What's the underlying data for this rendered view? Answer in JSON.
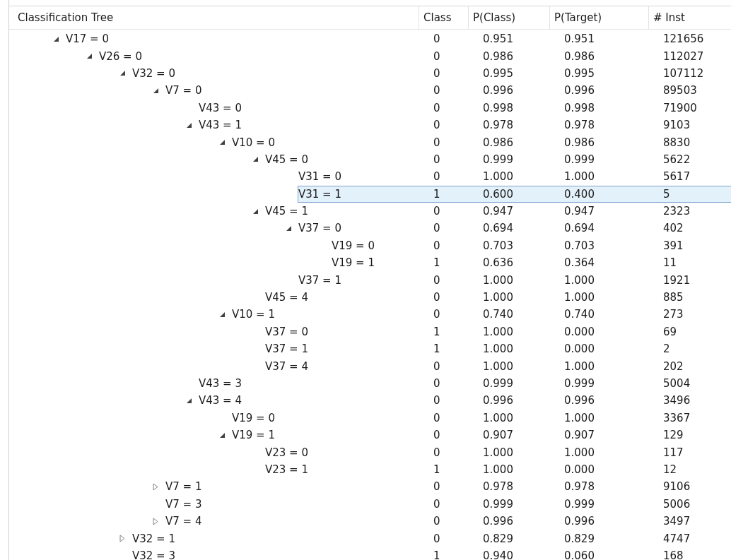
{
  "columns": [
    "Classification Tree",
    "Class",
    "P(Class)",
    "P(Target)",
    "# Inst"
  ],
  "tree": [
    {
      "label": "V17 = 0",
      "kind": "branch",
      "expanded": true,
      "selected": false,
      "class": "0",
      "p_class": "0.951",
      "p_target": "0.951",
      "inst": "121656",
      "children": [
        {
          "label": "V26 = 0",
          "kind": "branch",
          "expanded": true,
          "selected": false,
          "class": "0",
          "p_class": "0.986",
          "p_target": "0.986",
          "inst": "112027",
          "children": [
            {
              "label": "V32 = 0",
              "kind": "branch",
              "expanded": true,
              "selected": false,
              "class": "0",
              "p_class": "0.995",
              "p_target": "0.995",
              "inst": "107112",
              "children": [
                {
                  "label": "V7 = 0",
                  "kind": "branch",
                  "expanded": true,
                  "selected": false,
                  "class": "0",
                  "p_class": "0.996",
                  "p_target": "0.996",
                  "inst": "89503",
                  "children": [
                    {
                      "label": "V43 = 0",
                      "kind": "leaf",
                      "selected": false,
                      "class": "0",
                      "p_class": "0.998",
                      "p_target": "0.998",
                      "inst": "71900"
                    },
                    {
                      "label": "V43 = 1",
                      "kind": "branch",
                      "expanded": true,
                      "selected": false,
                      "class": "0",
                      "p_class": "0.978",
                      "p_target": "0.978",
                      "inst": "9103",
                      "children": [
                        {
                          "label": "V10 = 0",
                          "kind": "branch",
                          "expanded": true,
                          "selected": false,
                          "class": "0",
                          "p_class": "0.986",
                          "p_target": "0.986",
                          "inst": "8830",
                          "children": [
                            {
                              "label": "V45 = 0",
                              "kind": "branch",
                              "expanded": true,
                              "selected": false,
                              "class": "0",
                              "p_class": "0.999",
                              "p_target": "0.999",
                              "inst": "5622",
                              "children": [
                                {
                                  "label": "V31 = 0",
                                  "kind": "leaf",
                                  "selected": false,
                                  "class": "0",
                                  "p_class": "1.000",
                                  "p_target": "1.000",
                                  "inst": "5617"
                                },
                                {
                                  "label": "V31 = 1",
                                  "kind": "leaf",
                                  "selected": true,
                                  "class": "1",
                                  "p_class": "0.600",
                                  "p_target": "0.400",
                                  "inst": "5"
                                }
                              ]
                            },
                            {
                              "label": "V45 = 1",
                              "kind": "branch",
                              "expanded": true,
                              "selected": false,
                              "class": "0",
                              "p_class": "0.947",
                              "p_target": "0.947",
                              "inst": "2323",
                              "children": [
                                {
                                  "label": "V37 = 0",
                                  "kind": "branch",
                                  "expanded": true,
                                  "selected": false,
                                  "class": "0",
                                  "p_class": "0.694",
                                  "p_target": "0.694",
                                  "inst": "402",
                                  "children": [
                                    {
                                      "label": "V19 = 0",
                                      "kind": "leaf",
                                      "selected": false,
                                      "class": "0",
                                      "p_class": "0.703",
                                      "p_target": "0.703",
                                      "inst": "391"
                                    },
                                    {
                                      "label": "V19 = 1",
                                      "kind": "leaf",
                                      "selected": false,
                                      "class": "1",
                                      "p_class": "0.636",
                                      "p_target": "0.364",
                                      "inst": "11"
                                    }
                                  ]
                                },
                                {
                                  "label": "V37 = 1",
                                  "kind": "leaf",
                                  "selected": false,
                                  "class": "0",
                                  "p_class": "1.000",
                                  "p_target": "1.000",
                                  "inst": "1921"
                                }
                              ]
                            },
                            {
                              "label": "V45 = 4",
                              "kind": "leaf",
                              "selected": false,
                              "class": "0",
                              "p_class": "1.000",
                              "p_target": "1.000",
                              "inst": "885"
                            }
                          ]
                        },
                        {
                          "label": "V10 = 1",
                          "kind": "branch",
                          "expanded": true,
                          "selected": false,
                          "class": "0",
                          "p_class": "0.740",
                          "p_target": "0.740",
                          "inst": "273",
                          "children": [
                            {
                              "label": "V37 = 0",
                              "kind": "leaf",
                              "selected": false,
                              "class": "1",
                              "p_class": "1.000",
                              "p_target": "0.000",
                              "inst": "69"
                            },
                            {
                              "label": "V37 = 1",
                              "kind": "leaf",
                              "selected": false,
                              "class": "1",
                              "p_class": "1.000",
                              "p_target": "0.000",
                              "inst": "2"
                            },
                            {
                              "label": "V37 = 4",
                              "kind": "leaf",
                              "selected": false,
                              "class": "0",
                              "p_class": "1.000",
                              "p_target": "1.000",
                              "inst": "202"
                            }
                          ]
                        }
                      ]
                    },
                    {
                      "label": "V43 = 3",
                      "kind": "leaf",
                      "selected": false,
                      "class": "0",
                      "p_class": "0.999",
                      "p_target": "0.999",
                      "inst": "5004"
                    },
                    {
                      "label": "V43 = 4",
                      "kind": "branch",
                      "expanded": true,
                      "selected": false,
                      "class": "0",
                      "p_class": "0.996",
                      "p_target": "0.996",
                      "inst": "3496",
                      "children": [
                        {
                          "label": "V19 = 0",
                          "kind": "leaf",
                          "selected": false,
                          "class": "0",
                          "p_class": "1.000",
                          "p_target": "1.000",
                          "inst": "3367"
                        },
                        {
                          "label": "V19 = 1",
                          "kind": "branch",
                          "expanded": true,
                          "selected": false,
                          "class": "0",
                          "p_class": "0.907",
                          "p_target": "0.907",
                          "inst": "129",
                          "children": [
                            {
                              "label": "V23 = 0",
                              "kind": "leaf",
                              "selected": false,
                              "class": "0",
                              "p_class": "1.000",
                              "p_target": "1.000",
                              "inst": "117"
                            },
                            {
                              "label": "V23 = 1",
                              "kind": "leaf",
                              "selected": false,
                              "class": "1",
                              "p_class": "1.000",
                              "p_target": "0.000",
                              "inst": "12"
                            }
                          ]
                        }
                      ]
                    }
                  ]
                },
                {
                  "label": "V7 = 1",
                  "kind": "branch",
                  "expanded": false,
                  "selected": false,
                  "class": "0",
                  "p_class": "0.978",
                  "p_target": "0.978",
                  "inst": "9106"
                },
                {
                  "label": "V7 = 3",
                  "kind": "leaf",
                  "selected": false,
                  "class": "0",
                  "p_class": "0.999",
                  "p_target": "0.999",
                  "inst": "5006"
                },
                {
                  "label": "V7 = 4",
                  "kind": "branch",
                  "expanded": false,
                  "selected": false,
                  "class": "0",
                  "p_class": "0.996",
                  "p_target": "0.996",
                  "inst": "3497"
                }
              ]
            },
            {
              "label": "V32 = 1",
              "kind": "branch",
              "expanded": false,
              "selected": false,
              "class": "0",
              "p_class": "0.829",
              "p_target": "0.829",
              "inst": "4747"
            },
            {
              "label": "V32 = 3",
              "kind": "leaf",
              "selected": false,
              "class": "1",
              "p_class": "0.940",
              "p_target": "0.060",
              "inst": "168"
            }
          ]
        }
      ]
    }
  ]
}
